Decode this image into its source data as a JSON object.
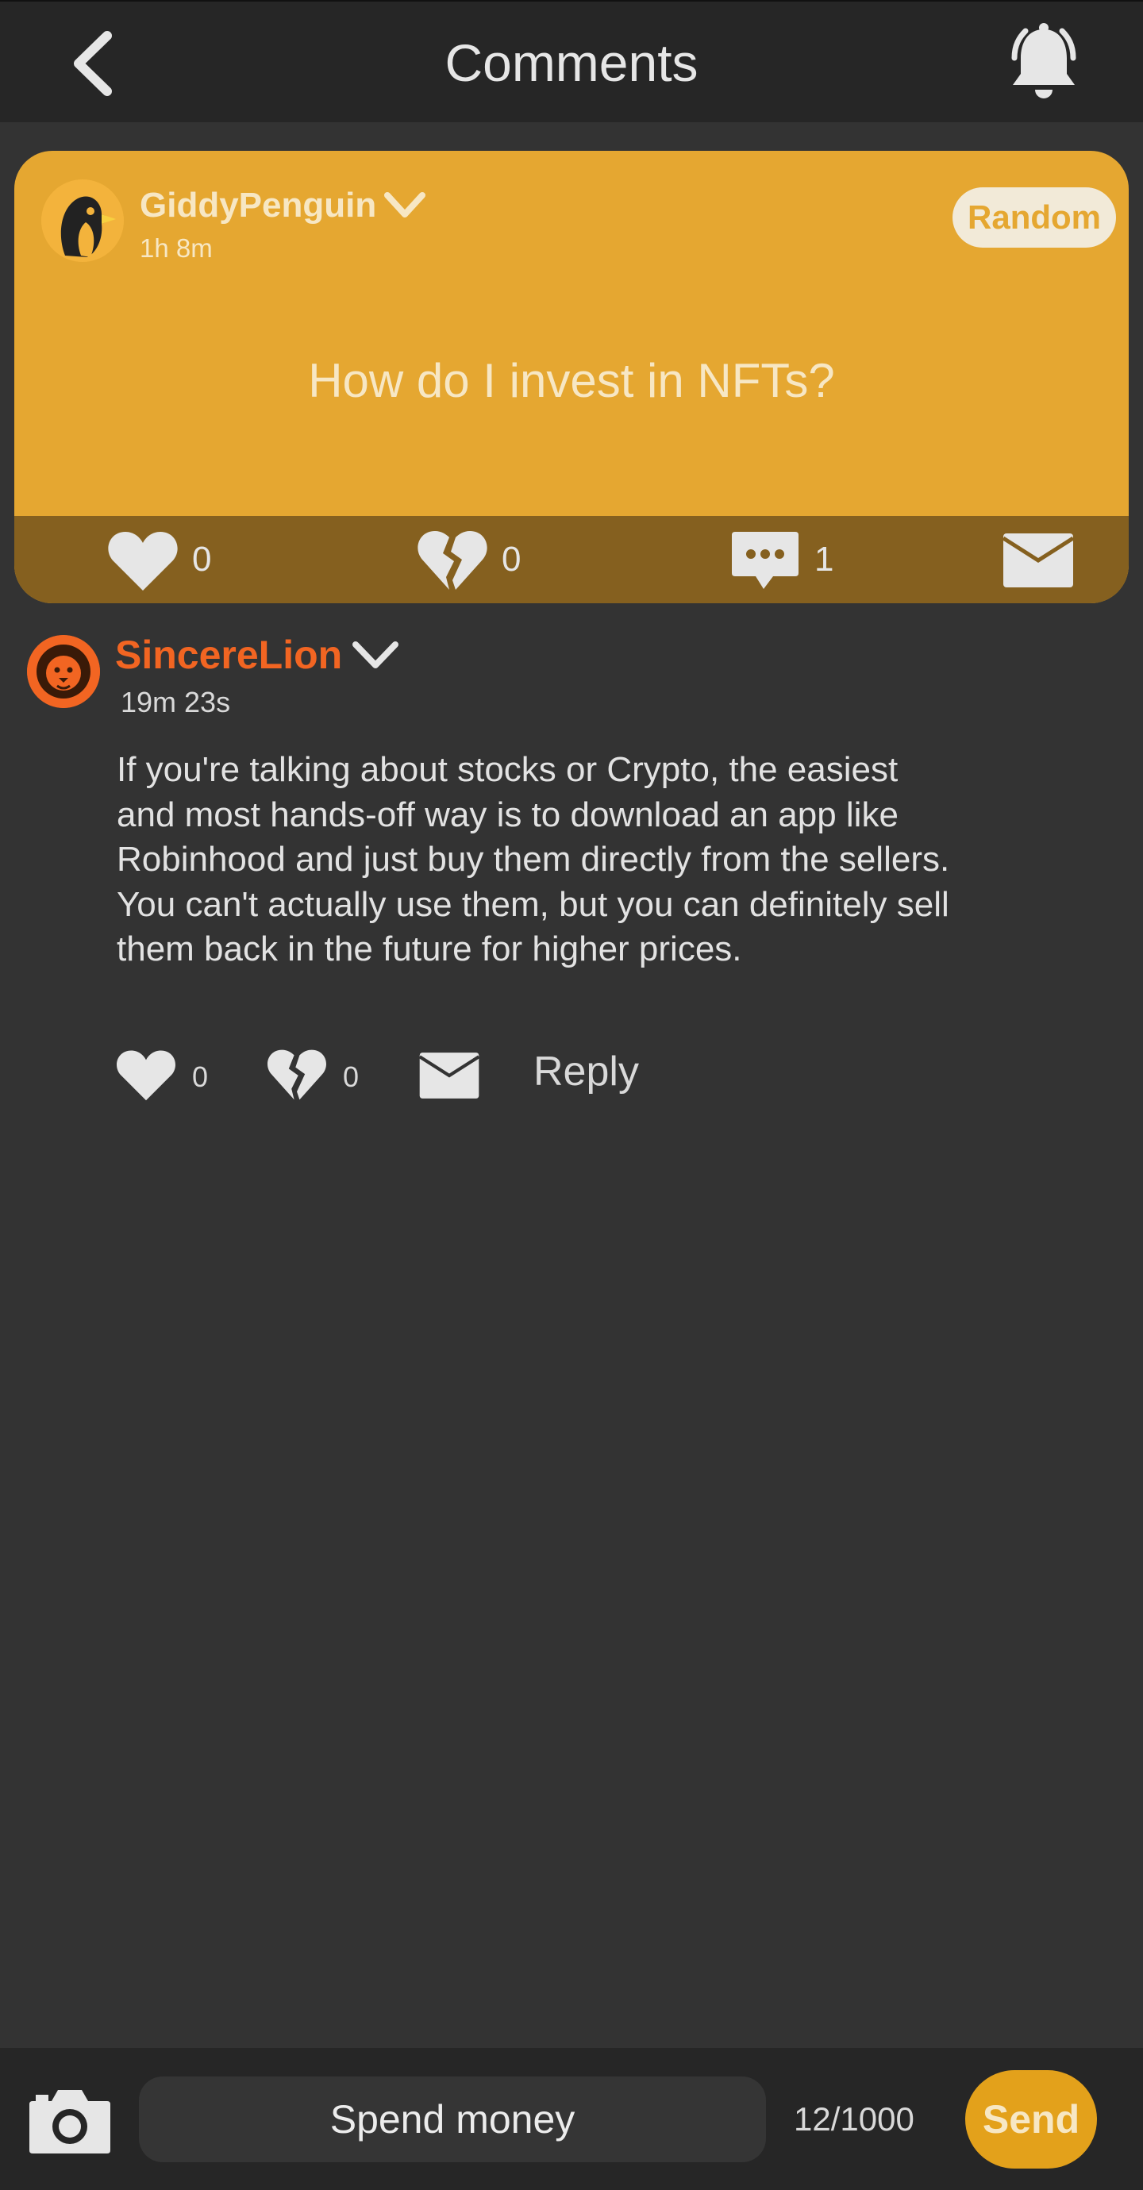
{
  "header": {
    "title": "Comments",
    "back_icon": "chevron-left-icon",
    "notification_icon": "bell-ringing-icon"
  },
  "post": {
    "username": "GiddyPenguin",
    "time_ago": "1h 8m",
    "avatar_icon": "penguin-avatar",
    "random_label": "Random",
    "question": "How do I invest in NFTs?",
    "likes": "0",
    "dislikes": "0",
    "comments": "1",
    "colors": {
      "card": "#e5a731",
      "action_bar": "#85601f"
    }
  },
  "comment": {
    "username": "SincereLion",
    "time_ago": "19m 23s",
    "avatar_icon": "lion-avatar",
    "body": "If you're talking about stocks or Crypto, the easiest and most hands-off way is to download an app like Robinhood and just buy them directly from the sellers. You can't actually use them, but you can definitely sell them back in the future for higher prices.",
    "likes": "0",
    "dislikes": "0",
    "reply_label": "Reply",
    "colors": {
      "username": "#f26522"
    }
  },
  "composer": {
    "input_value": "Spend money",
    "char_count": "12/1000",
    "send_label": "Send",
    "camera_icon": "camera-icon",
    "colors": {
      "send": "#e3a11b"
    }
  }
}
